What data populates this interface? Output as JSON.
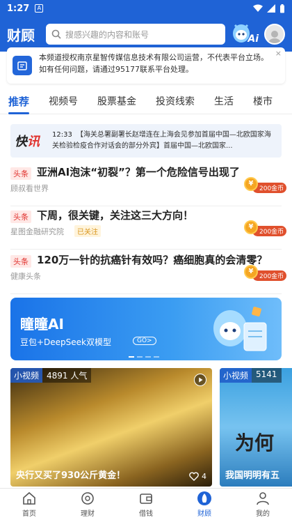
{
  "status_bar": {
    "time": "1:27"
  },
  "header": {
    "brand": "财顾",
    "search_placeholder": "搜感兴趣的内容和账号",
    "ai_badge": "Ai"
  },
  "notice": {
    "text": "本频道授权南京星智传媒信息技术有限公司运营，不代表平台立场。如有任何问题，请通过95177联系平台处理。",
    "close": "×"
  },
  "tabs": [
    {
      "label": "推荐",
      "active": true
    },
    {
      "label": "视频号"
    },
    {
      "label": "股票基金"
    },
    {
      "label": "投资线索"
    },
    {
      "label": "生活"
    },
    {
      "label": "楼市"
    }
  ],
  "flash": {
    "logo_main": "快",
    "logo_accent": "讯",
    "time": "12:33",
    "text": "【海关总署副署长赵增连在上海会见参加首届中国—北欧国家海关检验检疫合作对话会的部分外宾】首届中国—北欧国家..."
  },
  "news": [
    {
      "tag": "头条",
      "title": "亚洲AI泡沫“初裂”？第一个危险信号出现了",
      "source": "顾叔看世界",
      "followed": "",
      "reward": "200金币"
    },
    {
      "tag": "头条",
      "title": "下周，很关键，关注这三大方向！",
      "source": "星图金融研究院",
      "followed": "已关注",
      "reward": "200金币"
    },
    {
      "tag": "头条",
      "title": "120万一针的抗癌针有效吗？癌细胞真的会清零？",
      "source": "健康头条",
      "followed": "",
      "reward": "200金币"
    }
  ],
  "banner": {
    "title": "瞳瞳AI",
    "subtitle": "豆包+DeepSeek双模型",
    "go": "GO>"
  },
  "videos": [
    {
      "kind": "小视频",
      "views": "4891 人气",
      "title": "央行又买了930公斤黄金！",
      "likes": "4"
    },
    {
      "kind": "小视频",
      "views": "5141",
      "title": "我国明明有五",
      "overlay": "为何"
    }
  ],
  "bottom_nav": [
    {
      "label": "首页",
      "icon": "home-icon"
    },
    {
      "label": "理财",
      "icon": "wealth-icon"
    },
    {
      "label": "借钱",
      "icon": "wallet-icon"
    },
    {
      "label": "财顾",
      "icon": "advisor-icon",
      "active": true
    },
    {
      "label": "我的",
      "icon": "profile-icon"
    }
  ],
  "colors": {
    "brand_blue": "#1f63d6",
    "headline_red": "#e0312d",
    "coin_orange": "#f5a623"
  }
}
